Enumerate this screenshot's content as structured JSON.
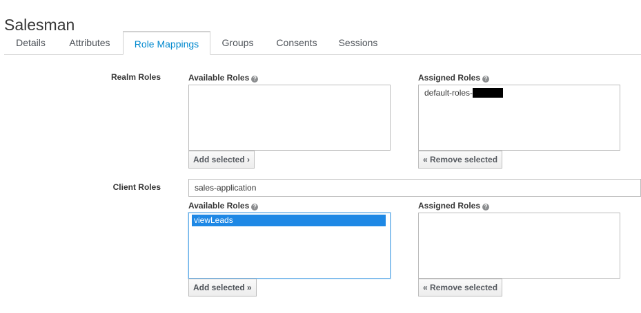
{
  "page": {
    "title": "Salesman"
  },
  "tabs": [
    {
      "label": "Details",
      "active": false
    },
    {
      "label": "Attributes",
      "active": false
    },
    {
      "label": "Role Mappings",
      "active": true
    },
    {
      "label": "Groups",
      "active": false
    },
    {
      "label": "Consents",
      "active": false
    },
    {
      "label": "Sessions",
      "active": false
    }
  ],
  "realm_roles": {
    "label": "Realm Roles",
    "available": {
      "label": "Available Roles",
      "items": []
    },
    "assigned": {
      "label": "Assigned Roles",
      "items": [
        "default-roles-"
      ]
    },
    "add_button": "Add selected ›",
    "remove_button": "« Remove selected"
  },
  "client_roles": {
    "label": "Client Roles",
    "client_select": {
      "value": "sales-application"
    },
    "available": {
      "label": "Available Roles",
      "items": [
        "viewLeads"
      ],
      "selected": "viewLeads"
    },
    "assigned": {
      "label": "Assigned Roles",
      "items": []
    },
    "add_button": "Add selected »",
    "remove_button": "« Remove selected"
  },
  "icons": {
    "help": "question-circle-icon",
    "redaction": "redaction-bar"
  },
  "colors": {
    "accent": "#0088ce",
    "selection": "#1e88e5",
    "focus_border": "#66afe9"
  }
}
